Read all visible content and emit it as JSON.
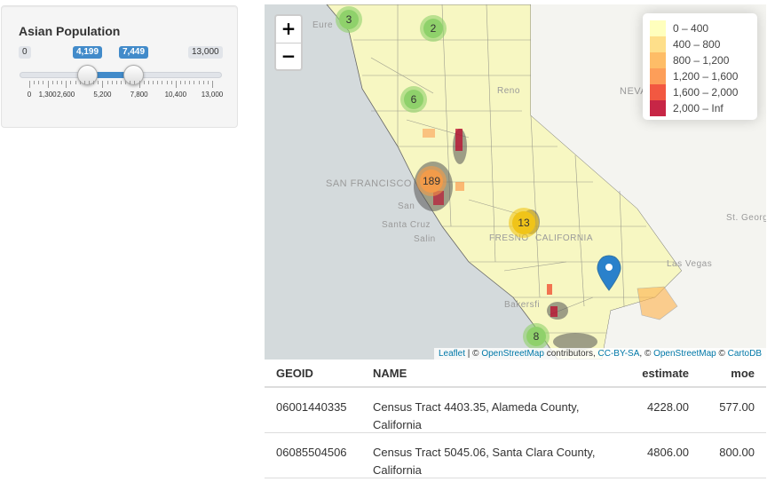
{
  "slider": {
    "title": "Asian Population",
    "min_label": "0",
    "max_label": "13,000",
    "from_label": "4,199",
    "to_label": "7,449",
    "from": 4199,
    "to": 7449,
    "range": [
      0,
      13000
    ],
    "tick_labels": [
      "0",
      "1,300",
      "2,600",
      "5,200",
      "7,800",
      "10,400",
      "13,000"
    ]
  },
  "map": {
    "zoom_in": "+",
    "zoom_out": "−",
    "places": [
      "Eure",
      "Reno",
      "NEVA",
      "SAN FRANCISCO",
      "San",
      "Santa Cruz",
      "Salin",
      "FRESNO",
      "CALIFORNIA",
      "Las Vegas",
      "St. Georg",
      "Bakersfi"
    ],
    "clusters": [
      {
        "count": "3",
        "color": "#8fd16b"
      },
      {
        "count": "2",
        "color": "#8fd16b"
      },
      {
        "count": "6",
        "color": "#8fd16b"
      },
      {
        "count": "189",
        "color": "#f29b4a"
      },
      {
        "count": "13",
        "color": "#f0c419"
      },
      {
        "count": "8",
        "color": "#8fd16b"
      }
    ],
    "legend": [
      {
        "label": "0 – 400",
        "color": "#ffffb2"
      },
      {
        "label": "400 – 800",
        "color": "#fed976"
      },
      {
        "label": "800 – 1,200",
        "color": "#feb24c"
      },
      {
        "label": "1,200 – 1,600",
        "color": "#fd8d3c"
      },
      {
        "label": "1,600 – 2,000",
        "color": "#f03b20"
      },
      {
        "label": "2,000 – Inf",
        "color": "#bd0026"
      }
    ],
    "attribution": {
      "leaflet": "Leaflet",
      "sep1": " | © ",
      "osm1": "OpenStreetMap",
      "mid": " contributors, ",
      "ccbysa": "CC-BY-SA",
      "sep2": ", © ",
      "osm2": "OpenStreetMap",
      "sep3": " © ",
      "carto": "CartoDB"
    }
  },
  "table": {
    "headers": [
      "GEOID",
      "NAME",
      "estimate",
      "moe"
    ],
    "rows": [
      {
        "geoid": "06001440335",
        "name": "Census Tract 4403.35, Alameda County, California",
        "estimate": "4228.00",
        "moe": "577.00"
      },
      {
        "geoid": "06085504506",
        "name": "Census Tract 5045.06, Santa Clara County, California",
        "estimate": "4806.00",
        "moe": "800.00"
      }
    ]
  }
}
